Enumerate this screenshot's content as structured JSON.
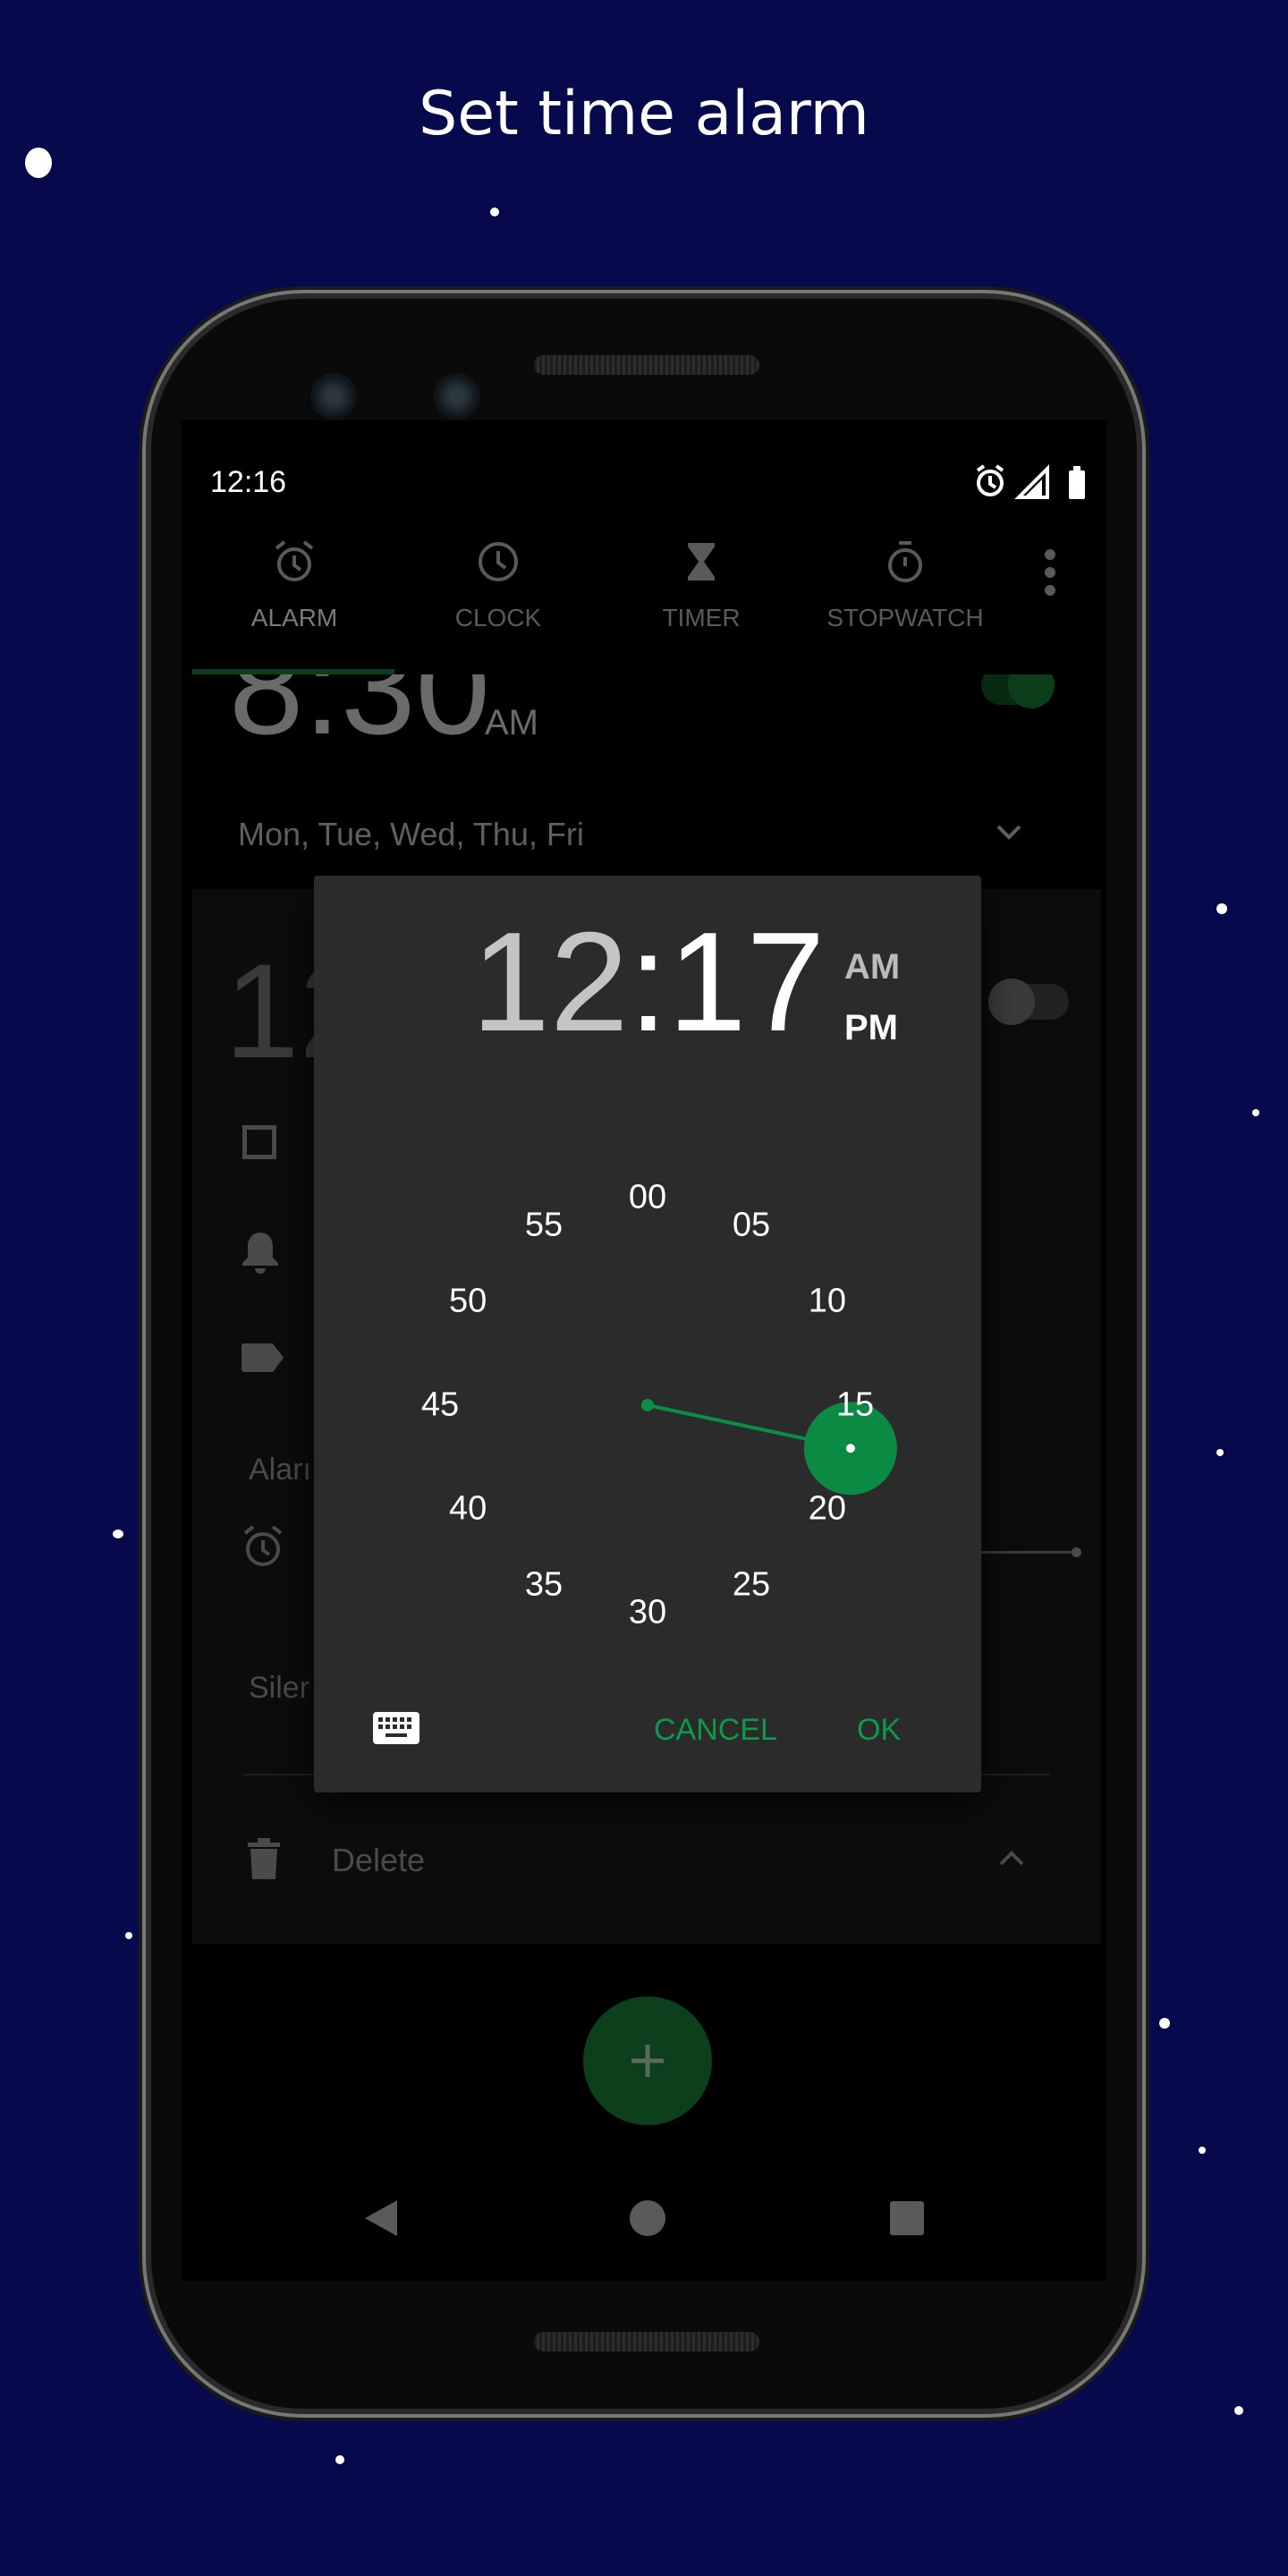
{
  "title": "Set time alarm",
  "status_bar": {
    "time": "12:16",
    "icons": [
      "alarm-icon",
      "signal-icon",
      "battery-icon"
    ]
  },
  "tabs": [
    {
      "label": "ALARM",
      "icon": "alarm-clock-icon",
      "selected": true
    },
    {
      "label": "CLOCK",
      "icon": "clock-icon",
      "selected": false
    },
    {
      "label": "TIMER",
      "icon": "hourglass-icon",
      "selected": false
    },
    {
      "label": "STOPWATCH",
      "icon": "stopwatch-icon",
      "selected": false
    }
  ],
  "alarm1": {
    "time": "8:30",
    "ampm": "AM",
    "days": "Mon, Tue, Wed, Thu, Fri",
    "enabled": true
  },
  "alarm2": {
    "time_partial": "12",
    "alarm_label_partial": "Aları",
    "silent_partial": "Siler",
    "delete_label": "Delete",
    "enabled": false
  },
  "dialog": {
    "hour": "12",
    "minute_text": ":17",
    "am": "AM",
    "pm": "PM",
    "selected_period": "PM",
    "selected_minute": 17,
    "minute_labels": [
      "00",
      "05",
      "10",
      "15",
      "20",
      "25",
      "30",
      "35",
      "40",
      "45",
      "50",
      "55"
    ],
    "cancel_label": "CANCEL",
    "ok_label": "OK",
    "accent": "#0a8f44"
  },
  "fab": {
    "icon": "plus-icon"
  },
  "nav": {
    "icons": [
      "back-icon",
      "home-icon",
      "recents-icon"
    ]
  }
}
